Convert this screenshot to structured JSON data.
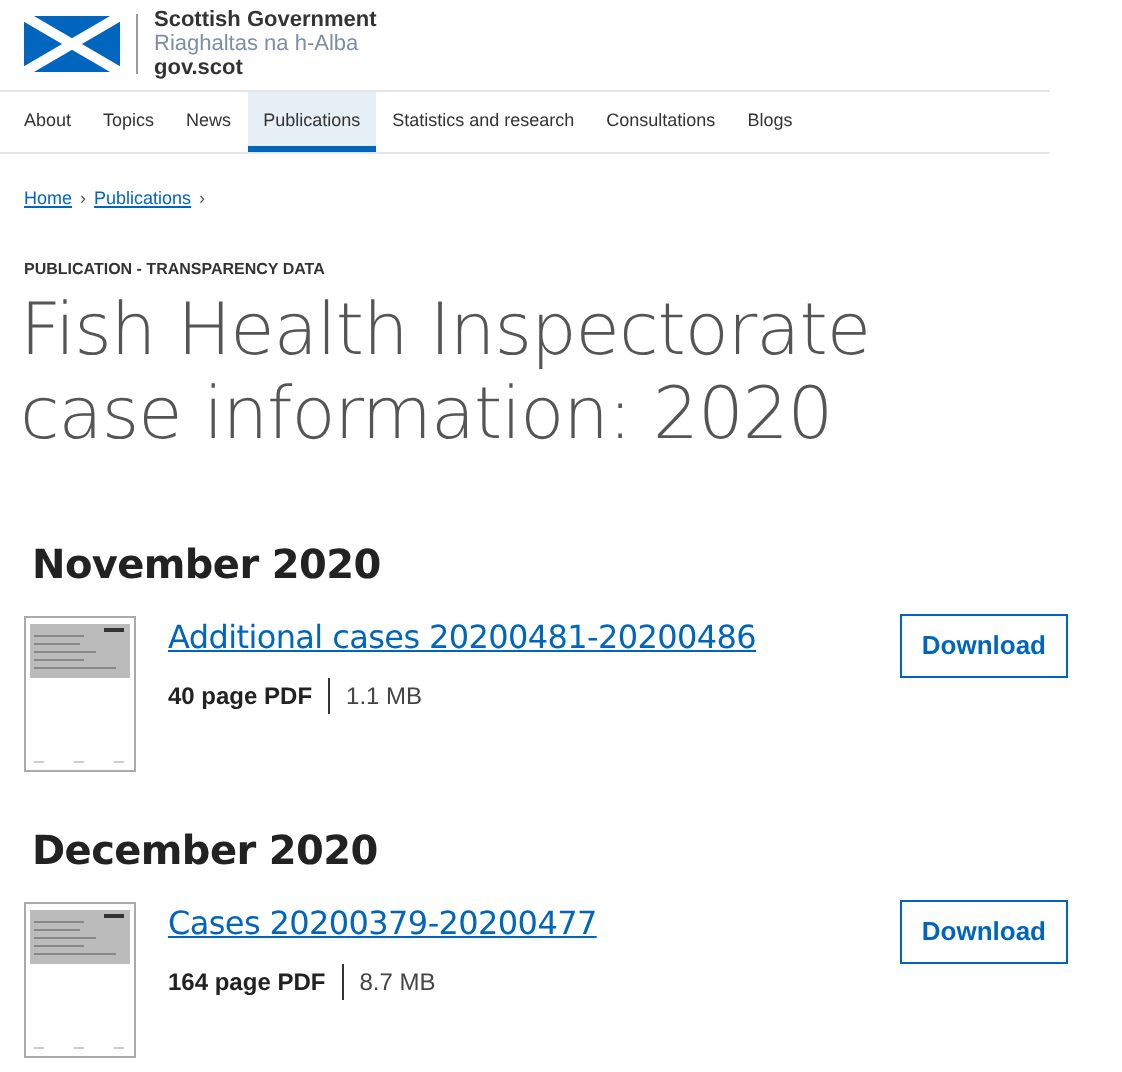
{
  "logo": {
    "name": "Scottish Government",
    "gaelic": "Riaghaltas na h-Alba",
    "site": "gov.scot"
  },
  "nav": [
    {
      "label": "About",
      "selected": false
    },
    {
      "label": "Topics",
      "selected": false
    },
    {
      "label": "News",
      "selected": false
    },
    {
      "label": "Publications",
      "selected": true
    },
    {
      "label": "Statistics and research",
      "selected": false
    },
    {
      "label": "Consultations",
      "selected": false
    },
    {
      "label": "Blogs",
      "selected": false
    }
  ],
  "breadcrumb": [
    "Home",
    "Publications"
  ],
  "breadcrumb_separator": "›",
  "label": "PUBLICATION - TRANSPARENCY DATA",
  "title": "Fish Health Inspectorate case information: 2020",
  "sections": [
    {
      "heading": "November 2020",
      "documents": [
        {
          "title": "Additional cases 20200481-20200486",
          "pages": "40 page PDF",
          "size": "1.1 MB",
          "button": "Download"
        }
      ]
    },
    {
      "heading": "December 2020",
      "documents": [
        {
          "title": "Cases 20200379-20200477",
          "pages": "164 page PDF",
          "size": "8.7 MB",
          "button": "Download"
        }
      ]
    }
  ]
}
